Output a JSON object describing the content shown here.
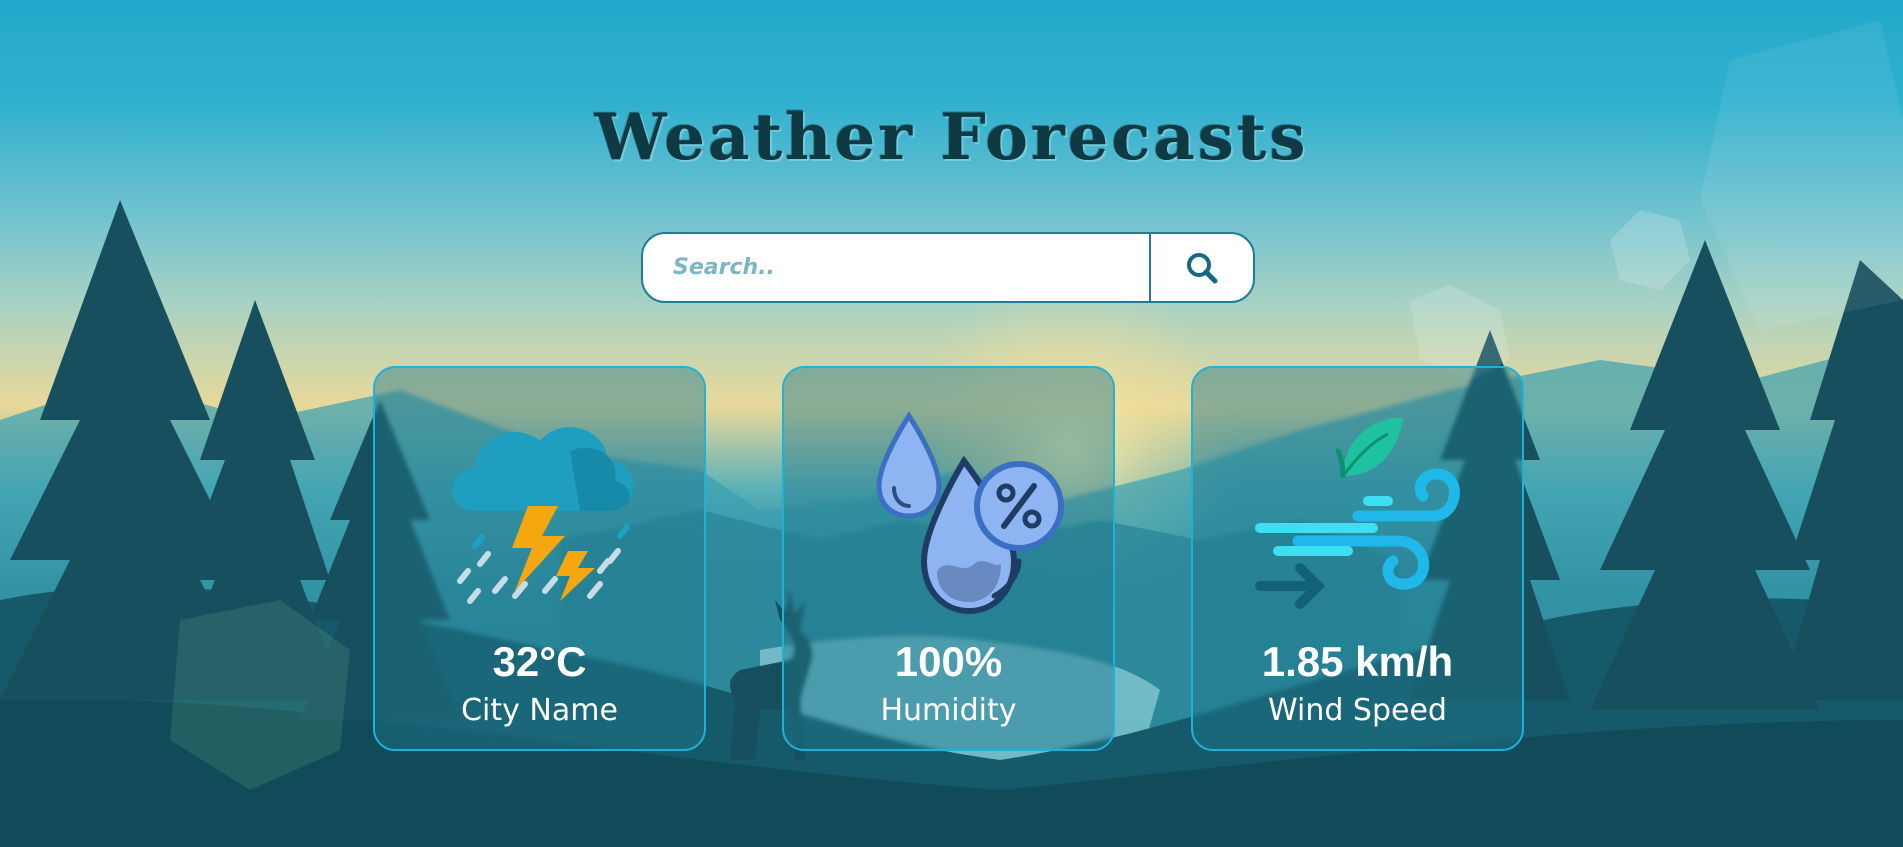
{
  "header": {
    "title": "Weather Forecasts"
  },
  "search": {
    "placeholder": "Search.."
  },
  "cards": [
    {
      "value": "32°C",
      "label": "City Name",
      "icon": "thunderstorm-rain-icon"
    },
    {
      "value": "100%",
      "label": "Humidity",
      "icon": "humidity-drop-icon"
    },
    {
      "value": "1.85 km/h",
      "label": "Wind Speed",
      "icon": "wind-icon"
    }
  ],
  "colors": {
    "accent": "#1a7f96",
    "card_border": "#1fb2d9",
    "title": "#0f3a43"
  }
}
